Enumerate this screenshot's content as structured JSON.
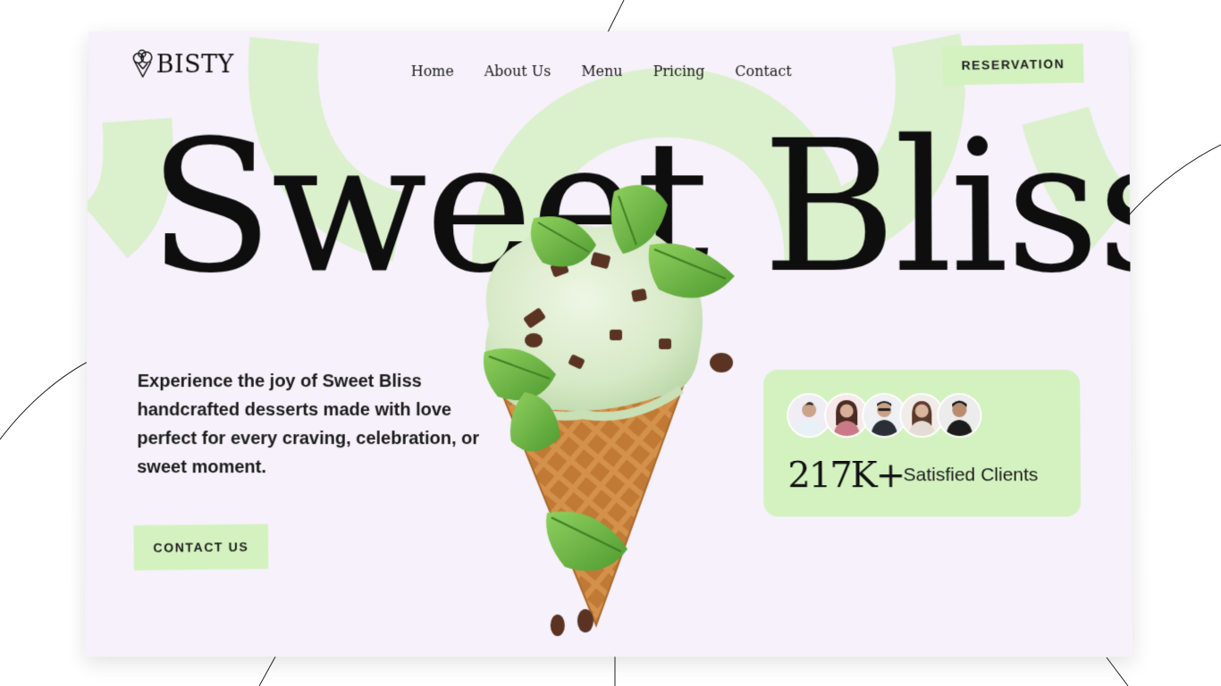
{
  "brand": {
    "name": "BISTY"
  },
  "nav": {
    "items": [
      {
        "label": "Home"
      },
      {
        "label": "About Us"
      },
      {
        "label": "Menu"
      },
      {
        "label": "Pricing"
      },
      {
        "label": "Contact"
      }
    ]
  },
  "header": {
    "reservation_label": "RESERVATION"
  },
  "hero": {
    "headline": "Sweet Bliss",
    "description": "Experience the joy of Sweet Bliss handcrafted desserts made with love perfect for every craving, celebration, or sweet moment.",
    "contact_label": "CONTACT US"
  },
  "stats": {
    "value": "217K+",
    "label": "Satisfied Clients",
    "avatar_count": 5
  },
  "colors": {
    "accent": "#d3f2bf",
    "background": "#f6f1fa",
    "text": "#111111"
  },
  "icons": {
    "logo": "ice-cream-icon"
  }
}
